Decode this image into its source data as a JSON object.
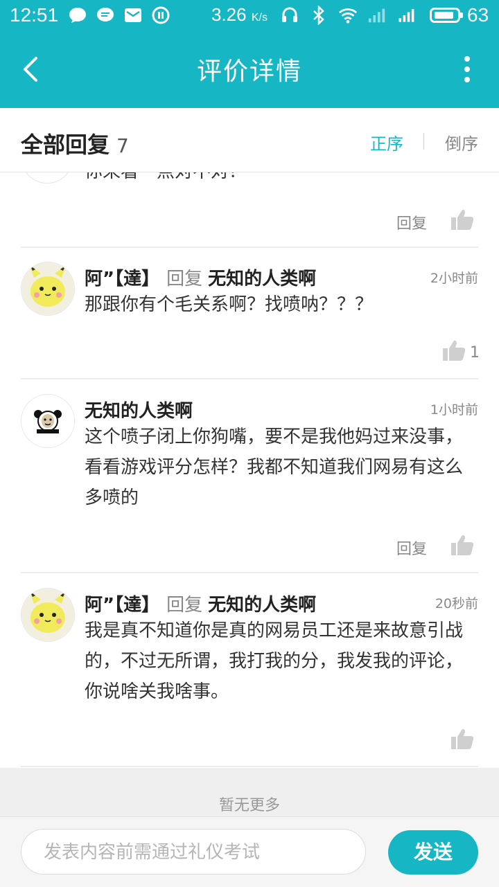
{
  "status_bar": {
    "time": "12:51",
    "speed": "3.26",
    "speed_unit": "K/s",
    "battery": "63",
    "network": "4G"
  },
  "header": {
    "title": "评价详情"
  },
  "replies_header": {
    "title": "全部回复",
    "count": "7",
    "sort_asc": "正序",
    "sort_desc": "倒序"
  },
  "partial_comment": {
    "text": "你来看一点对不对？",
    "reply_label": "回复"
  },
  "comments": [
    {
      "author": "阿”【達】",
      "reply_word": "回复",
      "reply_to": "无知的人类啊",
      "time": "2小时前",
      "text": "那跟你有个毛关系啊？找喷呐？？？",
      "likes": "1"
    },
    {
      "author": "无知的人类啊",
      "time": "1小时前",
      "text": "这个喷子闭上你狗嘴，要不是我他妈过来没事，看看游戏评分怎样？我都不知道我们网易有这么多喷的",
      "reply_label": "回复"
    },
    {
      "author": "阿”【達】",
      "reply_word": "回复",
      "reply_to": "无知的人类啊",
      "time": "20秒前",
      "text": "我是真不知道你是真的网易员工还是来故意引战的，不过无所谓，我打我的分，我发我的评论，你说啥关我啥事。"
    }
  ],
  "footer": {
    "no_more": "暂无更多",
    "input_placeholder": "发表内容前需通过礼仪考试",
    "send_label": "发送"
  },
  "colors": {
    "accent": "#16b6c5",
    "muted": "#888888"
  }
}
